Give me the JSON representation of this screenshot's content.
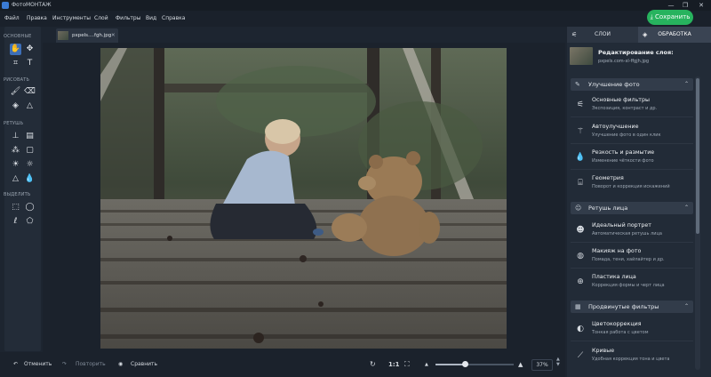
{
  "titlebar": {
    "title": "ФотоМОНТАЖ",
    "minimize": "—",
    "maximize": "❐",
    "close": "✕"
  },
  "menu": {
    "items": [
      "Файл",
      "Правка",
      "Инструменты",
      "Слой",
      "Фильтры",
      "Вид",
      "Справка"
    ],
    "save_label": "Сохранить"
  },
  "toolbar": {
    "sections": [
      "ОСНОВНЫЕ",
      "РИСОВАТЬ",
      "РЕТУШЬ",
      "ВЫДЕЛИТЬ"
    ]
  },
  "document": {
    "tab_name": "pxpels....fgh.jpg",
    "tab_close": "✕"
  },
  "bottom": {
    "undo": "Отменить",
    "redo": "Повторить",
    "compare": "Сравнить",
    "ratio": "1:1",
    "zoom": "37%",
    "zoom_fraction": 0.37
  },
  "right_panel": {
    "tabs": [
      "СЛОИ",
      "ОБРАБОТКА"
    ],
    "layer_title": "Редактирование слоя:",
    "layer_file": "pxpels.com-xl-ffgjh.jpg",
    "sections": [
      {
        "title": "Улучшение фото",
        "items": [
          {
            "title": "Основные фильтры",
            "subtitle": "Экспозиция, контраст и др."
          },
          {
            "title": "Автоулучшение",
            "subtitle": "Улучшение фото в один клик"
          },
          {
            "title": "Резкость и размытие",
            "subtitle": "Изменение чёткости фото"
          },
          {
            "title": "Геометрия",
            "subtitle": "Поворот и коррекция искажений"
          }
        ]
      },
      {
        "title": "Ретушь лица",
        "items": [
          {
            "title": "Идеальный портрет",
            "subtitle": "Автоматическая ретушь лица"
          },
          {
            "title": "Макияж на фото",
            "subtitle": "Помада, тени, хайлайтер и др."
          },
          {
            "title": "Пластика лица",
            "subtitle": "Коррекция формы и черт лица"
          }
        ]
      },
      {
        "title": "Продвинутые фильтры",
        "items": [
          {
            "title": "Цветокоррекция",
            "subtitle": "Тонкая работа с цветом"
          },
          {
            "title": "Кривые",
            "subtitle": "Удобная коррекция тона и цвета"
          }
        ]
      }
    ]
  },
  "colors": {
    "accent": "#27b35e",
    "active_tool": "#3d6fb8",
    "panel": "#222b37"
  }
}
